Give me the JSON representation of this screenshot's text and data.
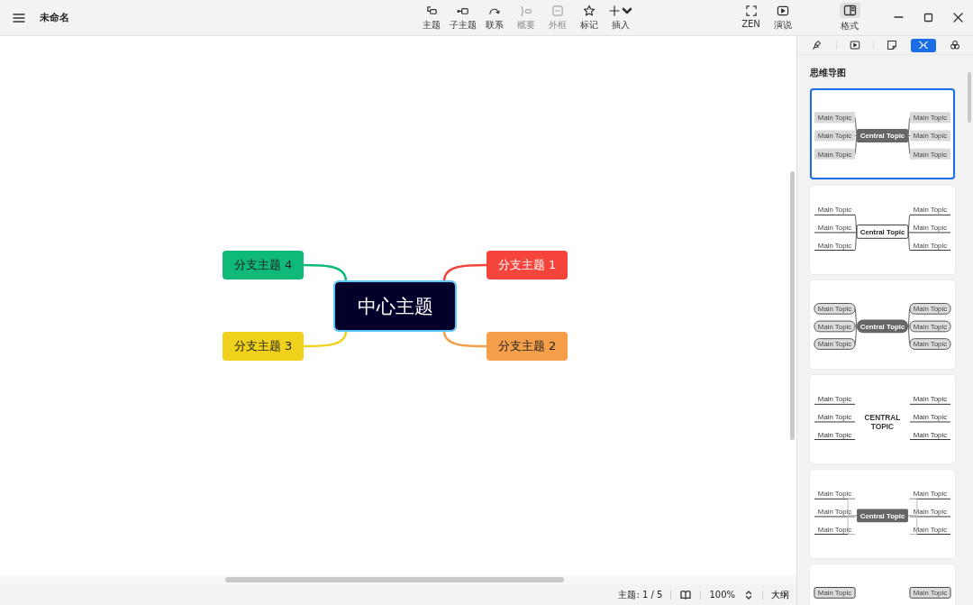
{
  "window": {
    "title": "未命名"
  },
  "toolbar": [
    {
      "label": "主题",
      "kind": "topic",
      "disabled": false
    },
    {
      "label": "子主题",
      "kind": "subtopic",
      "disabled": false
    },
    {
      "label": "联系",
      "kind": "relation",
      "disabled": false
    },
    {
      "label": "概要",
      "kind": "summary",
      "disabled": true
    },
    {
      "label": "外框",
      "kind": "boundary",
      "disabled": true
    },
    {
      "label": "标记",
      "kind": "marker",
      "disabled": false
    },
    {
      "label": "插入",
      "kind": "insert",
      "disabled": false
    }
  ],
  "view_buttons": [
    {
      "label": "ZEN",
      "kind": "zen"
    },
    {
      "label": "演说",
      "kind": "present"
    }
  ],
  "format_button": {
    "label": "格式",
    "selected": true
  },
  "mind_map": {
    "central": {
      "text": "中心主题",
      "selected": true
    },
    "branches": [
      {
        "text": "分支主题 4",
        "color": "#0fba78"
      },
      {
        "text": "分支主题 1",
        "color": "#f5443c"
      },
      {
        "text": "分支主题 3",
        "color": "#f0d21c"
      },
      {
        "text": "分支主题 2",
        "color": "#f59f4b"
      }
    ]
  },
  "panel": {
    "tabs": [
      {
        "kind": "brush",
        "selected": false
      },
      {
        "kind": "play",
        "selected": false
      },
      {
        "kind": "note",
        "selected": false
      },
      {
        "kind": "structure",
        "selected": true
      },
      {
        "kind": "circles",
        "selected": false
      }
    ],
    "section_title": "思维导图",
    "templates": [
      {
        "kind": "gray-box",
        "selected": true,
        "central": "Central Topic",
        "main_topics": [
          "Main Topic",
          "Main Topic",
          "Main Topic",
          "Main Topic",
          "Main Topic",
          "Main Topic"
        ]
      },
      {
        "kind": "underline",
        "selected": false,
        "central": "Central Topic",
        "main_topics": [
          "Main Topic",
          "Main Topic",
          "Main Topic",
          "Main Topic",
          "Main Topic",
          "Main Topic"
        ]
      },
      {
        "kind": "pill",
        "selected": false,
        "central": "Central Topic",
        "main_topics": [
          "Main Topic",
          "Main Topic",
          "Main Topic",
          "Main Topic",
          "Main Topic",
          "Main Topic"
        ]
      },
      {
        "kind": "caps",
        "selected": false,
        "central": "CENTRAL TOPIC",
        "main_topics": [
          "Main Topic",
          "Main Topic",
          "Main Topic",
          "Main Topic",
          "Main Topic",
          "Main Topic"
        ]
      },
      {
        "kind": "bracket",
        "selected": false,
        "central": "Central Topic",
        "main_topics": [
          "Main Topic",
          "Main Topic",
          "Main Topic",
          "Main Topic",
          "Main Topic",
          "Main Topic"
        ]
      },
      {
        "kind": "outlined",
        "selected": false,
        "main_topics": [
          "Main Topic",
          "Main Topic"
        ]
      }
    ]
  },
  "status_bar": {
    "topic_count": "主题: 1 / 5",
    "zoom": "100%",
    "outline": "大纲"
  }
}
